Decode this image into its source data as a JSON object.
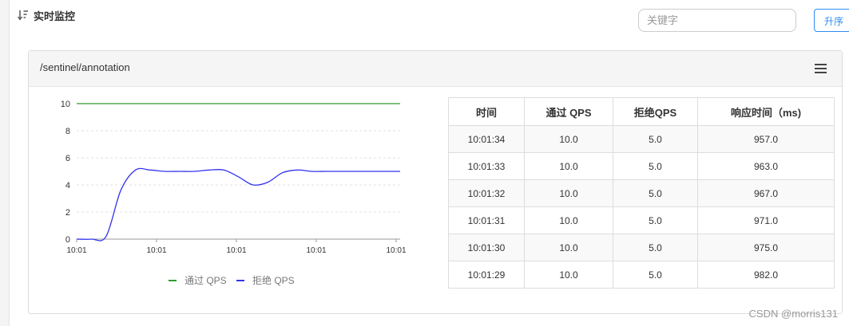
{
  "header": {
    "title": "实时监控",
    "search_placeholder": "关键字",
    "sort_label": "升序"
  },
  "card": {
    "title": "/sentinel/annotation"
  },
  "chart_data": {
    "type": "line",
    "x": [
      "10:01",
      "10:01",
      "10:01",
      "10:01",
      "10:01"
    ],
    "yticks": [
      0,
      2,
      4,
      6,
      8,
      10
    ],
    "ylim": [
      0,
      10
    ],
    "legend_position": "bottom",
    "series": [
      {
        "name": "通过 QPS",
        "color": "#2e9a2e",
        "values": [
          10,
          10,
          10,
          10,
          10,
          10,
          10,
          10,
          10,
          10,
          10,
          10,
          10,
          10,
          10,
          10,
          10,
          10,
          10,
          10,
          10,
          10,
          10
        ]
      },
      {
        "name": "拒绝 QPS",
        "color": "#3333ee",
        "values": [
          0,
          0,
          0.2,
          3.6,
          5.1,
          5.1,
          5,
          5,
          5,
          5.1,
          5.1,
          4.6,
          4,
          4.2,
          4.9,
          5.1,
          5,
          5,
          5,
          5,
          5,
          5,
          5
        ]
      }
    ]
  },
  "table": {
    "headers": [
      "时间",
      "通过 QPS",
      "拒绝QPS",
      "响应时间（ms)"
    ],
    "rows": [
      [
        "10:01:34",
        "10.0",
        "5.0",
        "957.0"
      ],
      [
        "10:01:33",
        "10.0",
        "5.0",
        "963.0"
      ],
      [
        "10:01:32",
        "10.0",
        "5.0",
        "967.0"
      ],
      [
        "10:01:31",
        "10.0",
        "5.0",
        "971.0"
      ],
      [
        "10:01:30",
        "10.0",
        "5.0",
        "975.0"
      ],
      [
        "10:01:29",
        "10.0",
        "5.0",
        "982.0"
      ]
    ]
  },
  "watermark": "CSDN @morris131"
}
